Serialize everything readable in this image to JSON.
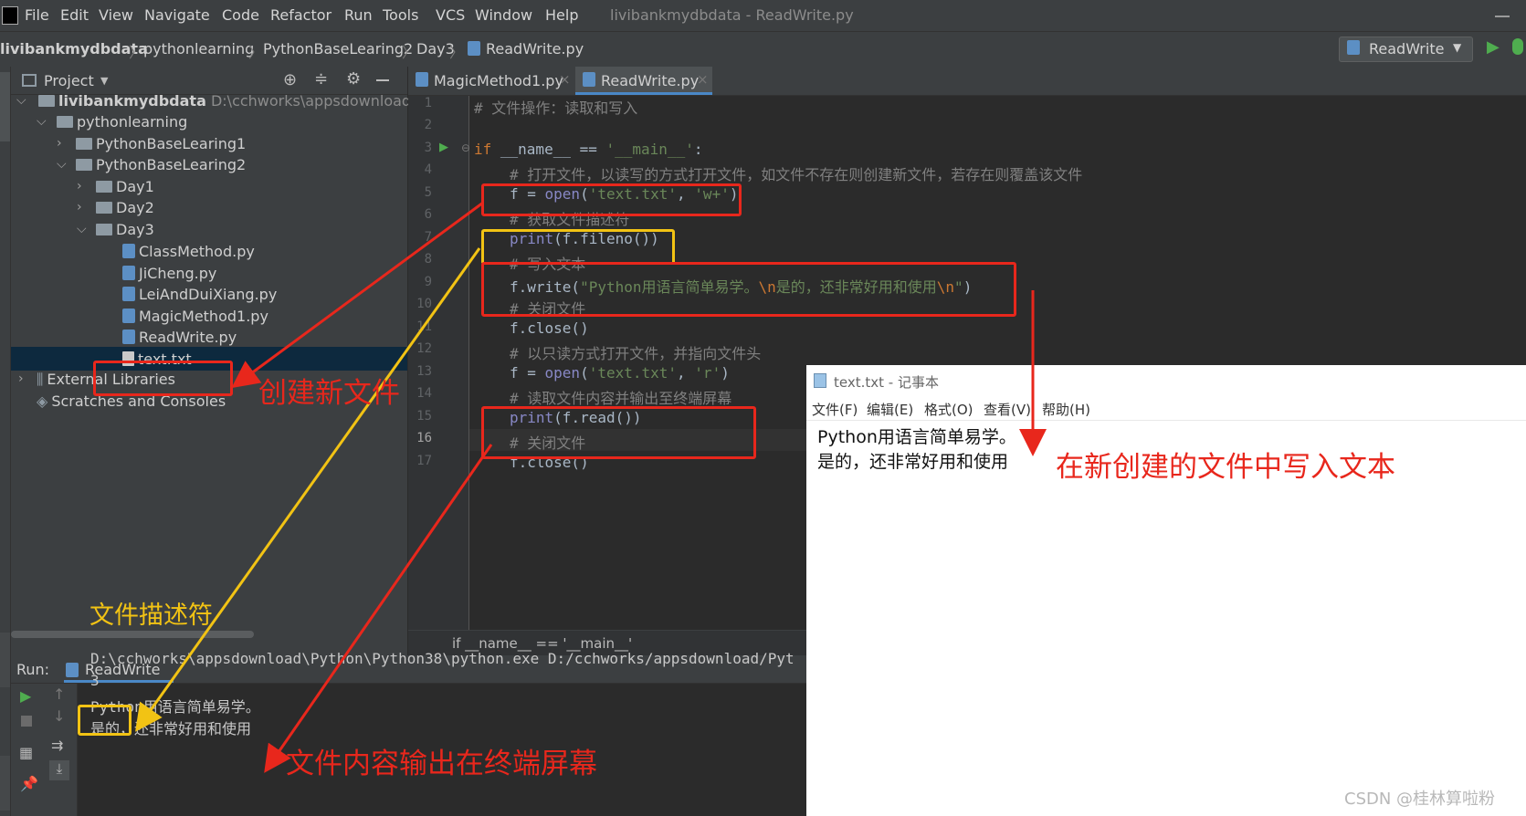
{
  "menubar": {
    "items": [
      "File",
      "Edit",
      "View",
      "Navigate",
      "Code",
      "Refactor",
      "Run",
      "Tools",
      "VCS",
      "Window",
      "Help"
    ],
    "window_title": "livibankmydbdata - ReadWrite.py"
  },
  "navbar": {
    "crumbs": [
      "livibankmydbdata",
      "pythonlearning",
      "PythonBaseLearing2",
      "Day3",
      "ReadWrite.py"
    ],
    "run_config": "ReadWrite"
  },
  "project": {
    "title": "Project",
    "tree": [
      {
        "label": "livibankmydbdata",
        "path": "D:\\cchworks\\appsdownload\\Pyth"
      },
      {
        "label": "pythonlearning"
      },
      {
        "label": "PythonBaseLearing1"
      },
      {
        "label": "PythonBaseLearing2"
      },
      {
        "label": "Day1"
      },
      {
        "label": "Day2"
      },
      {
        "label": "Day3"
      },
      {
        "label": "ClassMethod.py"
      },
      {
        "label": "JiCheng.py"
      },
      {
        "label": "LeiAndDuiXiang.py"
      },
      {
        "label": "MagicMethod1.py"
      },
      {
        "label": "ReadWrite.py"
      },
      {
        "label": "text.txt"
      },
      {
        "label": "External Libraries"
      },
      {
        "label": "Scratches and Consoles"
      }
    ]
  },
  "editor": {
    "tabs": [
      "MagicMethod1.py",
      "ReadWrite.py"
    ],
    "line_numbers": [
      "1",
      "2",
      "3",
      "4",
      "5",
      "6",
      "7",
      "8",
      "9",
      "10",
      "11",
      "12",
      "13",
      "14",
      "15",
      "16",
      "17"
    ],
    "code": {
      "l1": "# 文件操作：读取和写入",
      "l3_kw": "if",
      "l3_mid": " __name__ == ",
      "l3_str": "'__main__'",
      "l3_end": ":",
      "l4": "# 打开文件，以读写的方式打开文件，如文件不存在则创建新文件，若存在则覆盖该文件",
      "l5_a": "f = ",
      "l5_fn": "open",
      "l5_b": "(",
      "l5_s1": "'text.txt'",
      "l5_c": ", ",
      "l5_s2": "'w+'",
      "l5_d": ")",
      "l6": "# 获取文件描述符",
      "l7_fn": "print",
      "l7_rest": "(f.fileno())",
      "l8": "# 写入文本",
      "l9_a": "f.write(",
      "l9_s1": "\"Python用语言简单易学。",
      "l9_e1": "\\n",
      "l9_s2": "是的，还非常好用和使用",
      "l9_e2": "\\n",
      "l9_s3": "\"",
      "l9_b": ")",
      "l10": "# 关闭文件",
      "l11": "f.close()",
      "l12": "# 以只读方式打开文件，并指向文件头",
      "l13_a": "f = ",
      "l13_fn": "open",
      "l13_b": "(",
      "l13_s1": "'text.txt'",
      "l13_c": ", ",
      "l13_s2": "'r'",
      "l13_d": ")",
      "l14": "# 读取文件内容并输出至终端屏幕",
      "l15_fn": "print",
      "l15_rest": "(f.read())",
      "l16": "# 关闭文件",
      "l17": "f.close()"
    },
    "breadcrumb": "if __name__ == '__main__'"
  },
  "run": {
    "label": "Run:",
    "config": "ReadWrite",
    "console": [
      "D:\\cchworks\\appsdownload\\Python\\Python38\\python.exe D:/cchworks/appsdownload/Pyt",
      "3",
      "Python用语言简单易学。",
      "是的，还非常好用和使用"
    ]
  },
  "notepad": {
    "title": "text.txt - 记事本",
    "menu": [
      "文件(F)",
      "编辑(E)",
      "格式(O)",
      "查看(V)",
      "帮助(H)"
    ],
    "lines": [
      "Python用语言简单易学。",
      "是的，还非常好用和使用"
    ]
  },
  "annotations": {
    "create_file": "创建新文件",
    "file_descriptor": "文件描述符",
    "write_text": "在新创建的文件中写入文本",
    "console_output": "文件内容输出在终端屏幕"
  },
  "watermark": "CSDN @桂林算啦粉",
  "colors": {
    "annotation_red": "#e8271c",
    "annotation_yellow": "#f2c314",
    "keyword": "#cc7832",
    "string": "#6a8759",
    "comment": "#808080"
  }
}
